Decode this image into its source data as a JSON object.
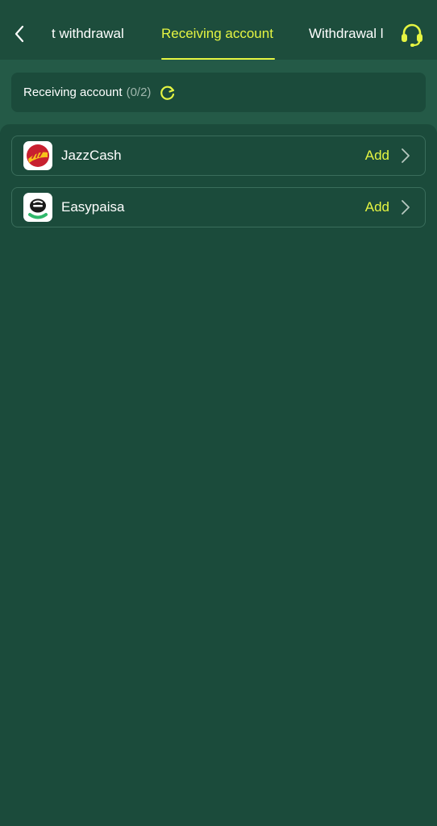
{
  "header": {
    "tabs": [
      {
        "label": "t withdrawal",
        "active": false
      },
      {
        "label": "Receiving account",
        "active": true
      },
      {
        "label": "Withdrawal l",
        "active": false
      }
    ],
    "icons": {
      "back": "chevron-left-icon",
      "support": "headset-icon"
    }
  },
  "summary": {
    "title": "Receiving account",
    "count": "(0/2)",
    "icon": "refresh-icon"
  },
  "accounts": [
    {
      "name": "JazzCash",
      "action": "Add",
      "logo": "jazzcash-logo"
    },
    {
      "name": "Easypaisa",
      "action": "Add",
      "logo": "easypaisa-logo"
    }
  ],
  "colors": {
    "background": "#1b4b3b",
    "header_band": "#245a47",
    "accent": "#e5f542",
    "muted_text": "#9fb7ad",
    "border": "#3a6d5b"
  }
}
